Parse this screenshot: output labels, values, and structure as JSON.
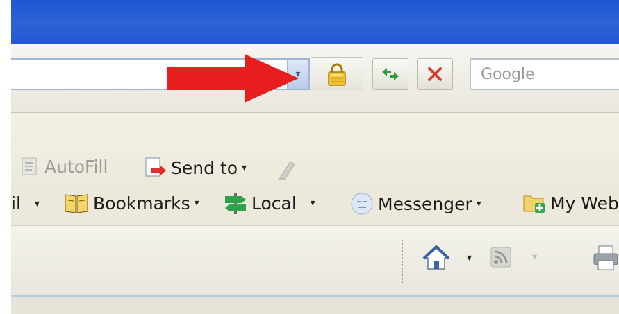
{
  "address_bar": {
    "url_value": "",
    "dropdown_icon": "chevron-down-icon",
    "lock_icon": "padlock-icon",
    "refresh_icon": "refresh-arrows-icon",
    "stop_icon": "stop-x-icon",
    "search_placeholder": "Google"
  },
  "annotation": {
    "arrow_icon": "red-arrow-icon",
    "arrow_color": "#e81e1e"
  },
  "toolbar": {
    "autofill_label": "AutoFill",
    "send_to_label": "Send to",
    "send_to_caret": "▾",
    "eraser_icon": "highlighter-icon"
  },
  "links_bar": {
    "mail_label": "il",
    "bookmarks_label": "Bookmarks",
    "local_label": "Local",
    "messenger_label": "Messenger",
    "my_web_label": "My Web",
    "caret": "▾"
  },
  "command_bar": {
    "home_icon": "home-icon",
    "feeds_icon": "rss-feed-icon",
    "print_icon": "printer-icon",
    "caret": "▾"
  },
  "colors": {
    "titlebar": "#2e63d6",
    "lock_yellow": "#e8b218",
    "stop_red": "#d93a2e",
    "refresh_green": "#2f9a3c",
    "link_blue": "#b8c8e2"
  }
}
